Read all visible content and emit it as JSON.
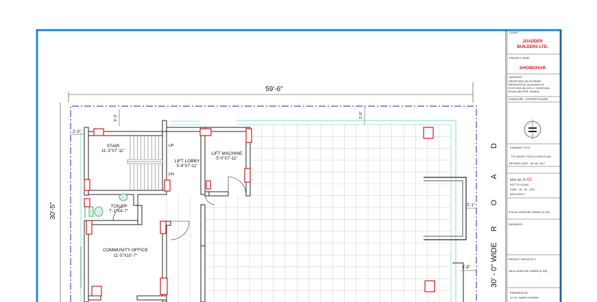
{
  "plan": {
    "overall_width": "59'-6\"",
    "overall_depth": "30'-5\"",
    "dim_small_1": "2'-0\"",
    "dim_small_2": "3'-3\"",
    "dim_small_3": "2'-0\"",
    "dim_small_4": "2'-1\"",
    "dim_small_5": "3'-8\"",
    "road_letters": [
      "D",
      "A",
      "O",
      "R"
    ],
    "road_width": "30' - 0\" WIDE",
    "rooms": {
      "stair_name": "STAIR",
      "stair_size": "11'-3\"X7'-11\"",
      "lift_lobby_name": "LIFT LOBBY",
      "lift_lobby_size": "5'-6\"X7'-11\"",
      "lift_machine_name": "LIFT MACHINE",
      "lift_machine_size": "5'-0\"X7'-11\"",
      "toilet_name": "TOILET",
      "toilet_size": "7'-1\"X4'-7\"",
      "office_name": "COMMUNITY OFFICE",
      "office_size": "11'-5\"X10'-7\""
    },
    "stair_up": "UP",
    "stair_dn": "DN"
  },
  "title_block": {
    "client_label": "CLIENT",
    "client_name_1": "JOADDER",
    "client_name_2": "BUILDERS LTD.",
    "project_label": "PROJECT NAME",
    "project_name": "SHOMAHAR",
    "address_label": "ADDRESS",
    "address_lines": [
      "PROPOSED 06-STORIED",
      "RESIDENTIAL BUILDING AT",
      "PLOT-8/12,BLOCK-C,TAJMOHAL",
      "ROAD,MD.PUR, DHAKA."
    ],
    "signature_label": "SIGNATURE : (OWNER'S NAME)",
    "drawing_title_label": "DRAWING TITLE",
    "drawing_title": "7TH (ROOF TOP) FLOOR PLAN",
    "revised_date": "REVISED DATE    : 06 -06- 2017",
    "drg_no_label": "DRG NO :",
    "drg_no": "A-03",
    "not_to_scale": "NOT TO SCALE",
    "date": "DATE      :  16 - 06 - 2021",
    "architect_label": "ARCHITECT",
    "architect_name": "S.JALAL UDDIN MD. AKBAR (A-128)",
    "engineer_label": "ENGINEER :",
    "project_architect_label": "PROJECT ARCHITECT",
    "project_architect_name": "JALAL UDDIN MD. AKBAR (A-128)",
    "prepared_by_label": "PREPARED BY",
    "prepared_by_name": "N.T.M. ZAMIR HOSSAIN"
  },
  "colors": {
    "frame": "#1e88d6",
    "wall_fill": "#ffffff",
    "wall_stroke": "#222222",
    "boundary": "#4848c8",
    "tile_grid": "#cfd6dc",
    "parapet": "#7fd8d8",
    "column": "#d01818",
    "brand_red": "#d01818",
    "fixture": "#28a060"
  }
}
